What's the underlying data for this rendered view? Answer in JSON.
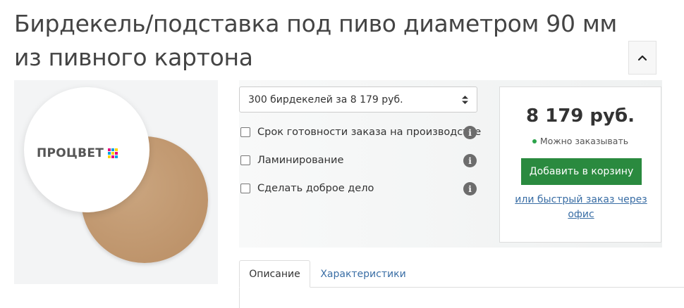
{
  "product": {
    "title": "Бирдекель/подставка под пиво диаметром 90 мм из пивного картона",
    "logo_text": "ПРОЦВЕТ"
  },
  "options": {
    "quantity_select": {
      "selected": "300 бирдекелей за 8 179 руб."
    },
    "checkboxes": [
      {
        "label": "Срок готовности заказа на производстве",
        "checked": false
      },
      {
        "label": "Ламинирование",
        "checked": false
      },
      {
        "label": "Сделать доброе дело",
        "checked": false
      }
    ]
  },
  "purchase": {
    "price": "8 179 руб.",
    "availability": "Можно заказывать",
    "add_to_cart_label": "Добавить в корзину",
    "quick_order_label": "или быстрый заказ через офис",
    "status_color": "#2ca34b",
    "button_color": "#2a8a3f",
    "link_color": "#3a6ea5"
  },
  "tabs": [
    {
      "label": "Описание",
      "active": true
    },
    {
      "label": "Характеристики",
      "active": false
    }
  ],
  "icons": {
    "collapse": "chevron-up-icon",
    "select": "sort-arrows-icon",
    "info": "info-icon"
  }
}
